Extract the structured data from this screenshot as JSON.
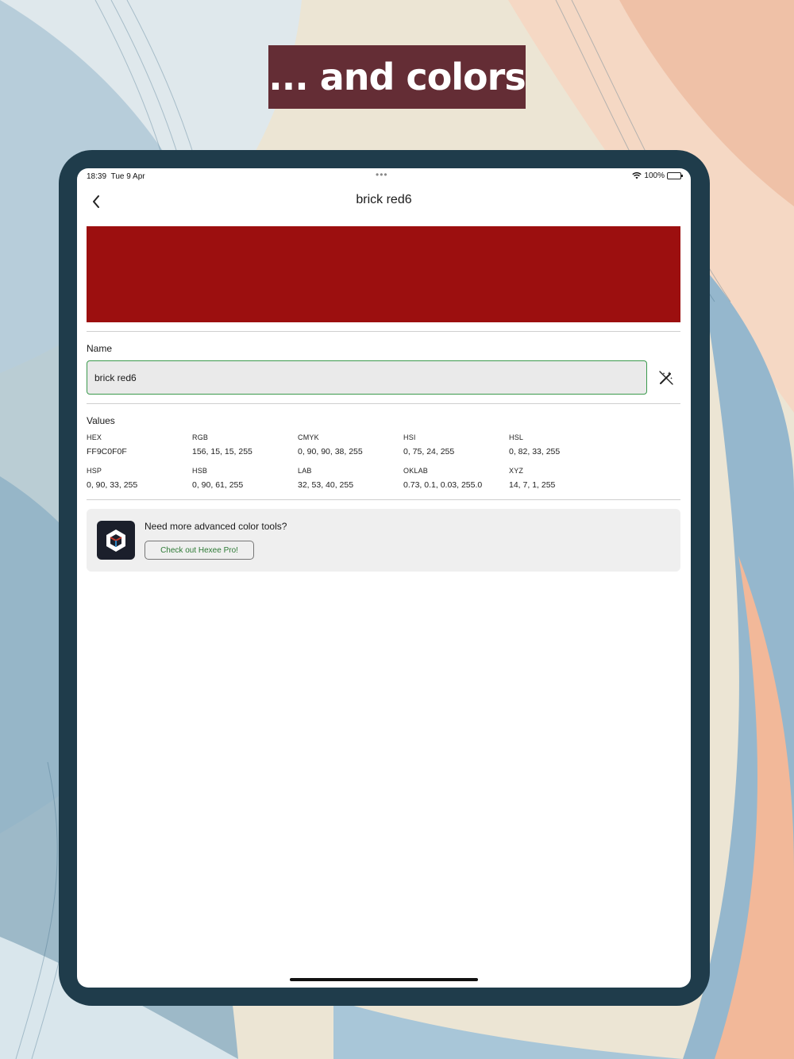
{
  "banner": {
    "text": "... and colors"
  },
  "colors": {
    "swatch": "#9c0f0f",
    "banner_bg": "#642d35",
    "device_frame": "#1f3c4b",
    "input_focus": "#3b9a4d",
    "cta_text": "#2d7a35"
  },
  "status_bar": {
    "time": "18:39",
    "date": "Tue 9 Apr",
    "dots": "•••",
    "battery": "100%"
  },
  "app_bar": {
    "back_icon": "chevron-left-icon",
    "title": "brick red6"
  },
  "name_section": {
    "label": "Name",
    "value": "brick red6",
    "magic_icon": "magic-wand-icon"
  },
  "values_section": {
    "label": "Values",
    "items": [
      {
        "label": "HEX",
        "value": "FF9C0F0F"
      },
      {
        "label": "RGB",
        "value": "156, 15, 15, 255"
      },
      {
        "label": "CMYK",
        "value": "0, 90, 90, 38, 255"
      },
      {
        "label": "HSI",
        "value": "0, 75, 24, 255"
      },
      {
        "label": "HSL",
        "value": "0, 82, 33, 255"
      },
      {
        "label": "HSP",
        "value": "0, 90, 33, 255"
      },
      {
        "label": "HSB",
        "value": "0, 90, 61, 255"
      },
      {
        "label": "LAB",
        "value": "32, 53, 40, 255"
      },
      {
        "label": "OKLAB",
        "value": "0.73, 0.1, 0.03, 255.0"
      },
      {
        "label": "XYZ",
        "value": "14, 7, 1, 255"
      }
    ]
  },
  "promo": {
    "logo_icon": "hexee-logo-icon",
    "message": "Need more advanced color tools?",
    "button_label": "Check out Hexee Pro!"
  }
}
